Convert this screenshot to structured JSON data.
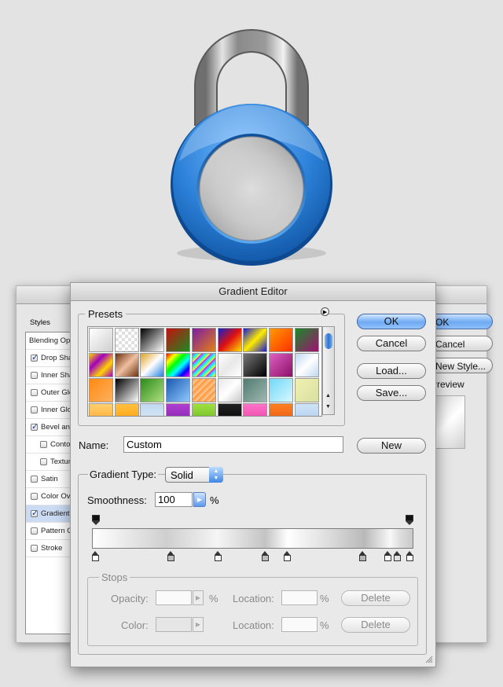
{
  "layer_style": {
    "list_header": "Styles",
    "items": [
      {
        "label": "Blending Options: Default",
        "checkbox": false,
        "checked": false,
        "indent": false
      },
      {
        "label": "Drop Shadow",
        "checkbox": true,
        "checked": true,
        "indent": false
      },
      {
        "label": "Inner Shadow",
        "checkbox": true,
        "checked": false,
        "indent": false
      },
      {
        "label": "Outer Glow",
        "checkbox": true,
        "checked": false,
        "indent": false
      },
      {
        "label": "Inner Glow",
        "checkbox": true,
        "checked": false,
        "indent": false
      },
      {
        "label": "Bevel and Emboss",
        "checkbox": true,
        "checked": true,
        "indent": false
      },
      {
        "label": "Contour",
        "checkbox": true,
        "checked": false,
        "indent": true
      },
      {
        "label": "Texture",
        "checkbox": true,
        "checked": false,
        "indent": true
      },
      {
        "label": "Satin",
        "checkbox": true,
        "checked": false,
        "indent": false
      },
      {
        "label": "Color Overlay",
        "checkbox": true,
        "checked": false,
        "indent": false
      },
      {
        "label": "Gradient Overlay",
        "checkbox": true,
        "checked": true,
        "indent": false,
        "selected": true
      },
      {
        "label": "Pattern Overlay",
        "checkbox": true,
        "checked": false,
        "indent": false
      },
      {
        "label": "Stroke",
        "checkbox": true,
        "checked": false,
        "indent": false
      }
    ],
    "ok_label": "OK",
    "cancel_label": "Cancel",
    "new_style_label": "New Style...",
    "preview_label": "Preview"
  },
  "gradient_editor": {
    "title": "Gradient Editor",
    "presets_label": "Presets",
    "ok_label": "OK",
    "cancel_label": "Cancel",
    "load_label": "Load...",
    "save_label": "Save...",
    "name_label": "Name:",
    "name_value": "Custom",
    "new_label": "New",
    "gradient_type_label": "Gradient Type:",
    "gradient_type_value": "Solid",
    "smoothness_label": "Smoothness:",
    "smoothness_value": "100",
    "smoothness_unit": "%",
    "stops_label": "Stops",
    "opacity_label": "Opacity:",
    "opacity_unit": "%",
    "location_label": "Location:",
    "location_unit": "%",
    "color_label": "Color:",
    "delete_label": "Delete",
    "opacity_stop_positions": [
      0,
      100
    ],
    "color_stop_positions": [
      0,
      24,
      39,
      54,
      61,
      85,
      93,
      96,
      100
    ],
    "presets": [
      "linear-gradient(135deg,#fff,#cfcfcf)",
      "repeating-conic-gradient(#e0e0e0 0 25%,#fff 0 50%) 0 0/8px 8px",
      "linear-gradient(135deg,#000,#fff)",
      "linear-gradient(135deg,#c41010,#1c8a20)",
      "linear-gradient(135deg,#7a1ca8,#e57f10)",
      "linear-gradient(135deg,#1022c8,#e01010,#ffe000)",
      "linear-gradient(135deg,#1a1ad0,#ffec00 50%,#1a1ad0)",
      "linear-gradient(135deg,#ff9a00,#ff3000)",
      "linear-gradient(135deg,#1a8a2a,#a01070)",
      "linear-gradient(135deg,#ffd400,#a000c0,#ffd400,#a000c0)",
      "linear-gradient(135deg,#6a3010,#f0c0a0,#6a3010)",
      "linear-gradient(135deg,#e0a020,#fff,#2080e0)",
      "linear-gradient(135deg,#f00,#ff0,#0f0,#0ff,#00f,#f0f)",
      "repeating-linear-gradient(135deg,#f0f,#0ff 4px,#ff0 8px)",
      "linear-gradient(135deg,#fff,#e8e8e8,#fff)",
      "linear-gradient(135deg,#777,#000)",
      "linear-gradient(135deg,#e060c0,#8a106a)",
      "linear-gradient(135deg,#bfd6f0,#ffffff,#bfd6f0)",
      "linear-gradient(135deg,#ff8a10,#ffb060)",
      "linear-gradient(135deg,#000,#fff)",
      "linear-gradient(135deg,#2a8a1a,#b0e080)",
      "linear-gradient(135deg,#1a5ab0,#90c8ff)",
      "repeating-linear-gradient(135deg,#ff9030,#ffd0a0 6px)",
      "linear-gradient(135deg,#e8e8e8,#ffffff,#c8c8c8)",
      "linear-gradient(135deg,#507a70,#a0b8b0)",
      "linear-gradient(135deg,#70d8f8,#d8f8ff)",
      "linear-gradient(135deg,#f0f0b0,#d8e0a0)",
      "linear-gradient(#ffd070,#ffa020)",
      "linear-gradient(#ffc040,#ff9a00)",
      "linear-gradient(#c0d8f0,#e0eefa)",
      "linear-gradient(#b040d0,#7a1ca8)",
      "linear-gradient(#a0e040,#60b020)",
      "linear-gradient(#222,#000)",
      "linear-gradient(#ff70c8,#e040a0)",
      "linear-gradient(#ff8020,#e05010)",
      "linear-gradient(#d0e4f8,#a8c8e8)"
    ]
  }
}
